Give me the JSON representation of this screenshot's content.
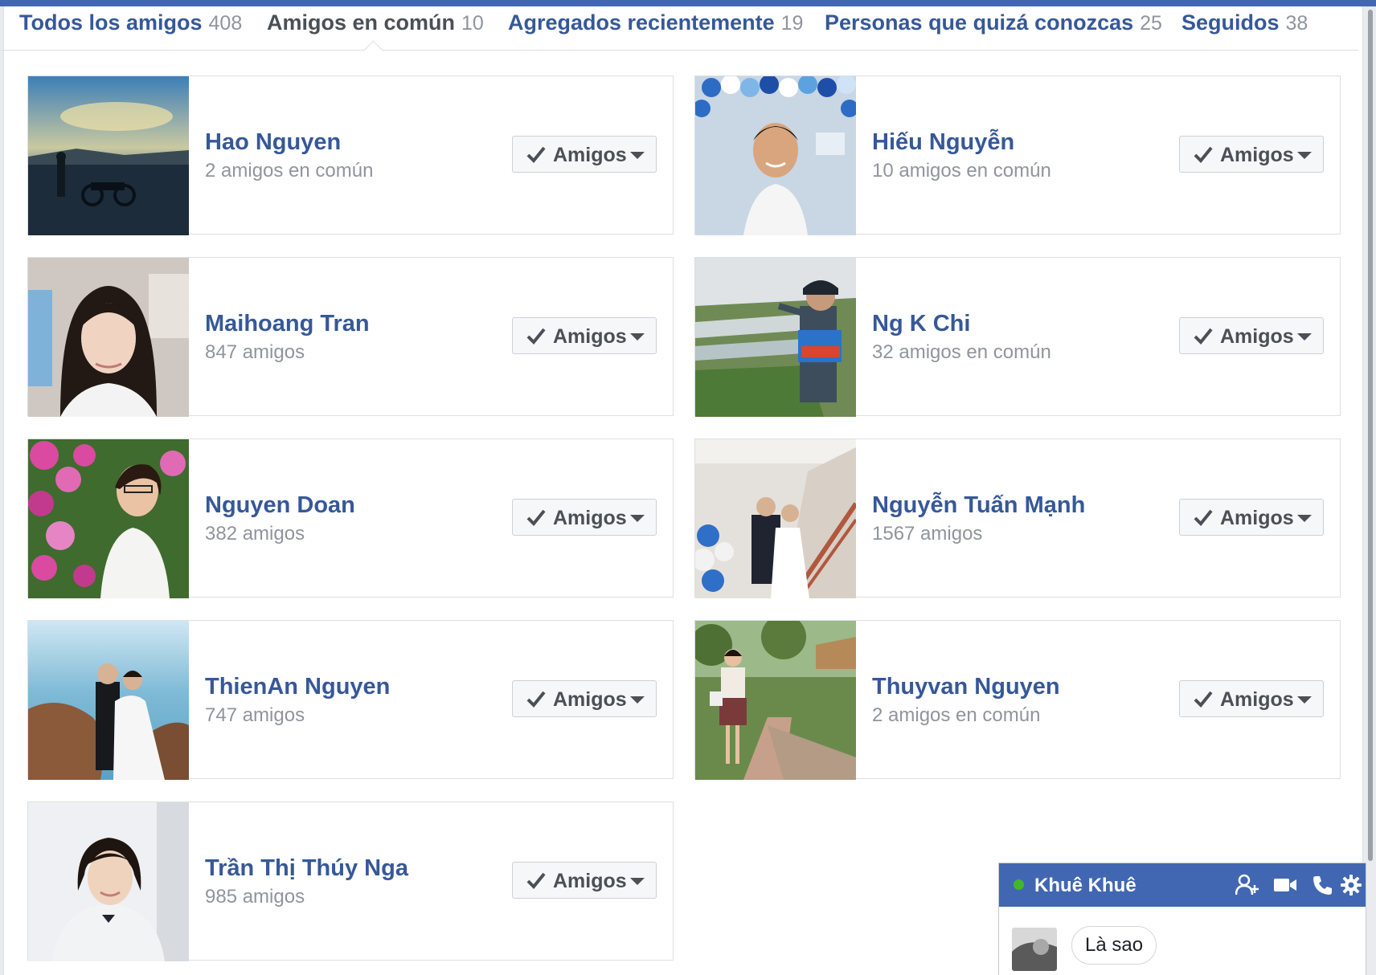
{
  "tabs": [
    {
      "label": "Todos los amigos",
      "count": "408",
      "active": false
    },
    {
      "label": "Amigos en común",
      "count": "10",
      "active": true
    },
    {
      "label": "Agregados recientemente",
      "count": "19",
      "active": false
    },
    {
      "label": "Personas que quizá conozcas",
      "count": "25",
      "active": false
    },
    {
      "label": "Seguidos",
      "count": "38",
      "active": false
    }
  ],
  "friends": [
    {
      "name": "Hao Nguyen",
      "subtitle": "2 amigos en común",
      "button": "Amigos"
    },
    {
      "name": "Hiếu Nguyễn",
      "subtitle": "10 amigos en común",
      "button": "Amigos"
    },
    {
      "name": "Maihoang Tran",
      "subtitle": "847 amigos",
      "button": "Amigos"
    },
    {
      "name": "Ng K Chi",
      "subtitle": "32 amigos en común",
      "button": "Amigos"
    },
    {
      "name": "Nguyen Doan",
      "subtitle": "382 amigos",
      "button": "Amigos"
    },
    {
      "name": "Nguyễn Tuấn Mạnh",
      "subtitle": "1567 amigos",
      "button": "Amigos"
    },
    {
      "name": "ThienAn Nguyen",
      "subtitle": "747 amigos",
      "button": "Amigos"
    },
    {
      "name": "Thuyvan Nguyen",
      "subtitle": "2 amigos en común",
      "button": "Amigos"
    },
    {
      "name": "Trần Thị Thúy Nga",
      "subtitle": "985 amigos",
      "button": "Amigos"
    }
  ],
  "chat": {
    "contact": "Khuê Khuê",
    "status": "online",
    "message": "Là sao",
    "icons": [
      "add-friend-icon",
      "video-call-icon",
      "phone-icon",
      "settings-gear-icon"
    ]
  },
  "colors": {
    "brand": "#4267b2",
    "link": "#365899",
    "muted": "#90949c",
    "online": "#42b72a"
  }
}
